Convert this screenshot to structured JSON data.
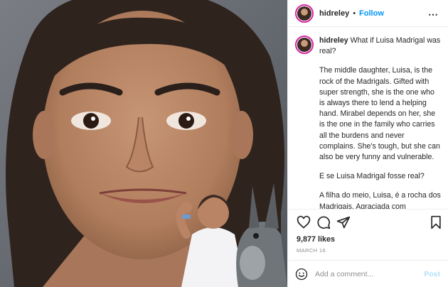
{
  "header": {
    "username": "hidreley",
    "separator": "•",
    "follow_label": "Follow",
    "more_icon": "more-icon"
  },
  "caption": {
    "username": "hidreley",
    "title": "What if Luisa Madrigal was real?",
    "paragraphs": [
      "The middle daughter, Luisa, is the rock of the Madrigals. Gifted with super strength, she is the one who is always there to lend a helping hand. Mirabel depends on her, she is the one in the family who carries all the burdens and never complains. She's tough, but she can also be very funny and vulnerable.",
      "E se Luisa Madrigal fosse real?",
      "A filha do meio, Luisa, é a rocha dos Madrigais. Agraciada com superforça, ela é aquela que está sempre lá para dar uma mãozinha. É com ela que Mirabel depende, é ela que está na família que carrega todos os fardos"
    ]
  },
  "actions": {
    "icons": [
      "heart-icon",
      "comment-icon",
      "share-icon",
      "bookmark-icon"
    ]
  },
  "likes": "9,877 likes",
  "date": "MARCH 16",
  "comment_box": {
    "placeholder": "Add a comment...",
    "post_label": "Post"
  },
  "colors": {
    "link_blue": "#0095f6",
    "post_disabled": "#b2dffc",
    "text": "#262626",
    "muted": "#8e8e8e",
    "border": "#efefef"
  }
}
